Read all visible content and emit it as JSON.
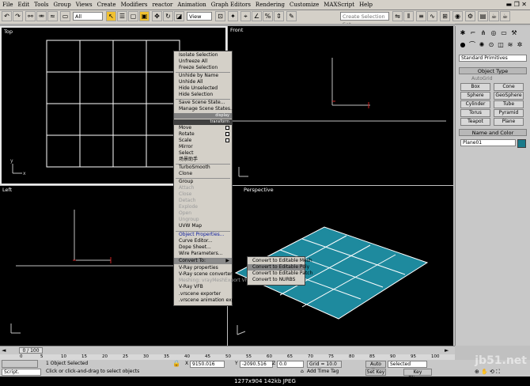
{
  "menubar": {
    "items": [
      "File",
      "Edit",
      "Tools",
      "Group",
      "Views",
      "Create",
      "Modifiers",
      "reactor",
      "Animation",
      "Graph Editors",
      "Rendering",
      "Customize",
      "MAXScript",
      "Help"
    ]
  },
  "toolbar": {
    "selection_filter": "All",
    "reference_coord": "View",
    "named_selection_placeholder": "Create Selection Set"
  },
  "viewports": {
    "top_label": "Top",
    "front_label": "Front",
    "left_label": "Left",
    "persp_label": "Perspective"
  },
  "quad_menu": {
    "display_items": [
      "Isolate Selection",
      "Unfreeze All",
      "Freeze Selection",
      "Unhide by Name",
      "Unhide All",
      "Hide Unselected",
      "Hide Selection",
      "Save Scene State...",
      "Manage Scene States..."
    ],
    "display_header": "display",
    "transform_header": "transform",
    "transform_items": [
      "Move",
      "Rotate",
      "Scale",
      "Mirror",
      "Select",
      "场景助手",
      "TurboSmooth",
      "Clone",
      "Group",
      "Attach",
      "Close",
      "Detach",
      "Explode",
      "Open",
      "Ungroup",
      "UVW Map",
      "Object Properties...",
      "Curve Editor...",
      "Dope Sheet...",
      "Wire Parameters...",
      "Convert To:",
      "V-Ray properties",
      "V-Ray scene converter",
      "Meshing: vrayMeshExport VRay",
      "V-Ray VFB",
      ".vrscene exporter",
      ".vrscene animation exporter"
    ],
    "convert_submenu": [
      "Convert to Editable Mesh",
      "Convert to Editable Poly",
      "Convert to Editable Patch",
      "Convert to NURBS"
    ],
    "convert_highlighted": "Convert to Editable Poly"
  },
  "command_panel": {
    "category": "Standard Primitives",
    "object_type_title": "Object Type",
    "autogrid": "AutoGrid",
    "buttons": [
      "Box",
      "Cone",
      "Sphere",
      "GeoSphere",
      "Cylinder",
      "Tube",
      "Torus",
      "Pyramid",
      "Teapot",
      "Plane"
    ],
    "name_color_title": "Name and Color",
    "object_name": "Plane01",
    "object_color": "#1a7a8a"
  },
  "timeline": {
    "frame": "0 / 100",
    "ticks": [
      "0",
      "5",
      "10",
      "15",
      "20",
      "25",
      "30",
      "35",
      "40",
      "45",
      "50",
      "55",
      "60",
      "65",
      "70",
      "75",
      "80",
      "85",
      "90",
      "95",
      "100"
    ]
  },
  "status": {
    "script_label": "Script.",
    "selection_info": "1 Object Selected",
    "prompt": "Click or click-and-drag to select objects",
    "x_label": "X",
    "x_value": "9150.016",
    "y_label": "Y",
    "y_value": "-2090.516",
    "z_label": "Z",
    "z_value": "0.0",
    "grid": "Grid = 10.0",
    "add_time_tag": "Add Time Tag",
    "auto_key": "Auto Key",
    "set_key": "Set Key",
    "key_mode": "Selected",
    "key_filters": "Key Filters..."
  },
  "watermark": "jb51.net",
  "caption": "1277x904  142kb  JPEG"
}
